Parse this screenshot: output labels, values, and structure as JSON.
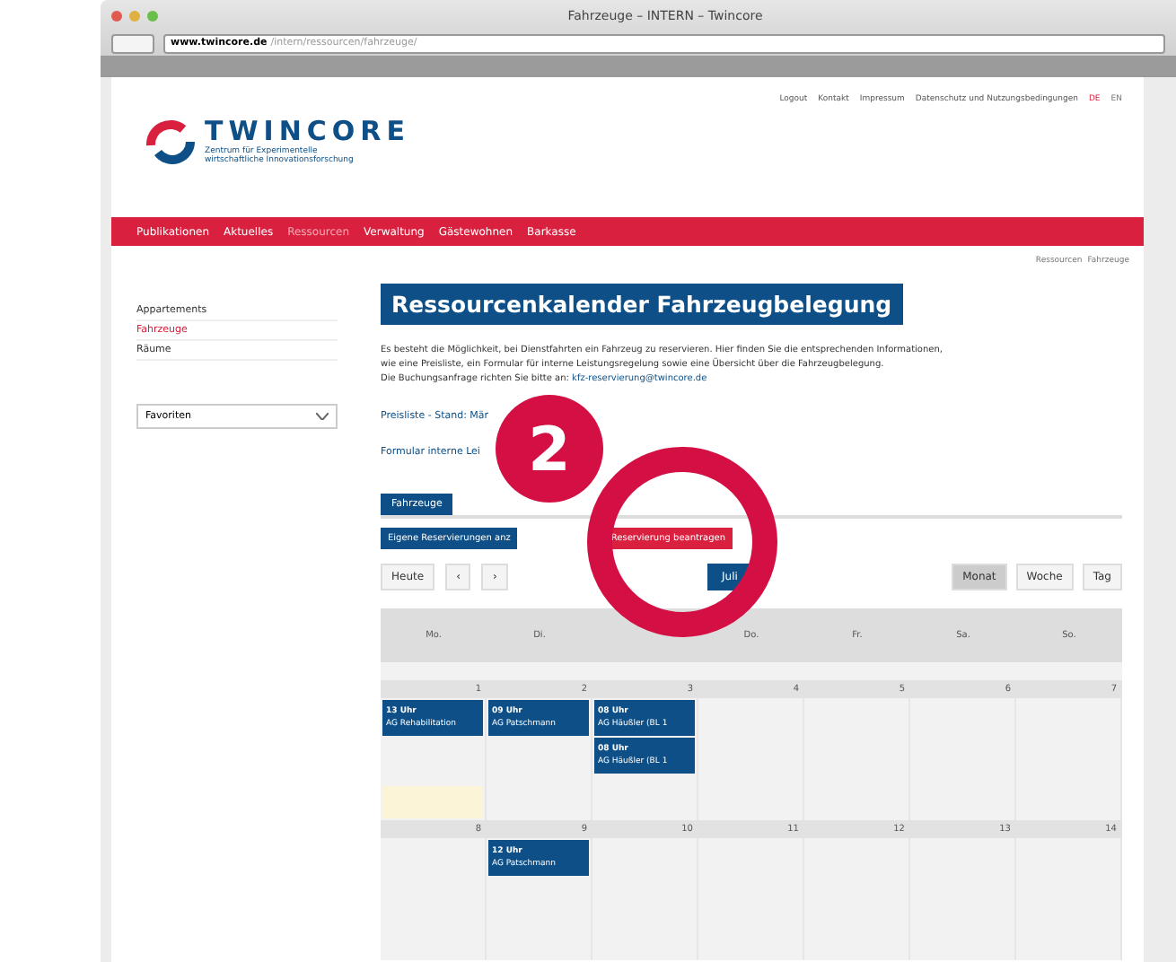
{
  "browser": {
    "title": "Fahrzeuge – INTERN – Twincore",
    "url_host": "www.twincore.de",
    "url_path": "/intern/ressourcen/fahrzeuge/"
  },
  "header": {
    "logo": "TWINCORE",
    "tagline": [
      "Zentrum für Experimentelle",
      "wirtschaftliche Innovationsforschung"
    ],
    "top_links": [
      "Logout",
      "Kontakt",
      "Impressum",
      "Datenschutz und Nutzungsbedingungen"
    ],
    "languages": [
      {
        "label": "DE",
        "selected": true
      },
      {
        "label": "EN",
        "selected": false
      }
    ]
  },
  "nav": [
    {
      "label": "Publikationen",
      "selected": false
    },
    {
      "label": "Aktuelles",
      "selected": false
    },
    {
      "label": "Ressourcen",
      "selected": true
    },
    {
      "label": "Verwaltung",
      "selected": false
    },
    {
      "label": "Gästewohnen",
      "selected": false
    },
    {
      "label": "Barkasse",
      "selected": false
    }
  ],
  "breadcrumb": [
    "Ressourcen",
    "Fahrzeuge"
  ],
  "sidebar": {
    "items": [
      {
        "label": "Appartements",
        "selected": false
      },
      {
        "label": "Fahrzeuge",
        "selected": true
      },
      {
        "label": "Räume",
        "selected": false
      }
    ],
    "select": {
      "value": "Favoriten"
    }
  },
  "content": {
    "heading": "Ressourcenkalender Fahrzeugbelegung",
    "paragraph": [
      "Es besteht die Möglichkeit, bei Dienstfahrten ein Fahrzeug zu reservieren. Hier finden Sie die entsprechenden Informationen,",
      "wie eine Preisliste, ein Formular für interne Leistungsregelung sowie eine Übersicht über die Fahrzeugbelegung."
    ],
    "request_text": "Die Buchungsanfrage richten Sie bitte an:",
    "email": "kfz-reservierung@twincore.de",
    "links": [
      "Preisliste - Stand: Mär",
      "Formular interne Lei"
    ]
  },
  "tabs": [
    {
      "label": "Fahrzeuge",
      "selected": true
    }
  ],
  "actions": [
    {
      "label": "Eigene Reservierungen anz",
      "kind": "primary"
    },
    {
      "label": "Reservierung beantragen",
      "kind": "danger"
    }
  ],
  "toolbar": {
    "today": "Heute",
    "prev": "‹",
    "next": "›",
    "period": "Juli",
    "views": [
      {
        "label": "Monat",
        "selected": true
      },
      {
        "label": "Woche",
        "selected": false
      },
      {
        "label": "Tag",
        "selected": false
      }
    ]
  },
  "calendar": {
    "days": [
      "Mo.",
      "Di.",
      "Do.",
      "Fr.",
      "Sa.",
      "So."
    ],
    "weeks": [
      {
        "days": [
          {
            "date": "1",
            "today": true,
            "events": [
              {
                "time": "13 Uhr",
                "title": "AG Rehabilitation"
              }
            ]
          },
          {
            "date": "2",
            "today": false,
            "events": [
              {
                "time": "09 Uhr",
                "title": "AG Patschmann"
              }
            ]
          },
          {
            "date": "3",
            "today": false,
            "events": [
              {
                "time": "08 Uhr",
                "title": "AG Häußler (BL 1"
              },
              {
                "time": "08 Uhr",
                "title": "AG Häußler (BL 1"
              }
            ]
          },
          {
            "date": "4",
            "today": false
          },
          {
            "date": "5",
            "today": false
          },
          {
            "date": "6",
            "today": false
          },
          {
            "date": "7",
            "today": false
          }
        ]
      },
      {
        "days": [
          {
            "date": "8",
            "today": false
          },
          {
            "date": "9",
            "today": false,
            "events": [
              {
                "time": "12 Uhr",
                "title": "AG Patschmann"
              }
            ]
          },
          {
            "date": "10",
            "today": false
          },
          {
            "date": "11",
            "today": false
          },
          {
            "date": "12",
            "today": false
          },
          {
            "date": "13",
            "today": false
          },
          {
            "date": "14",
            "today": false
          }
        ]
      }
    ]
  },
  "callout": {
    "number": "2"
  }
}
